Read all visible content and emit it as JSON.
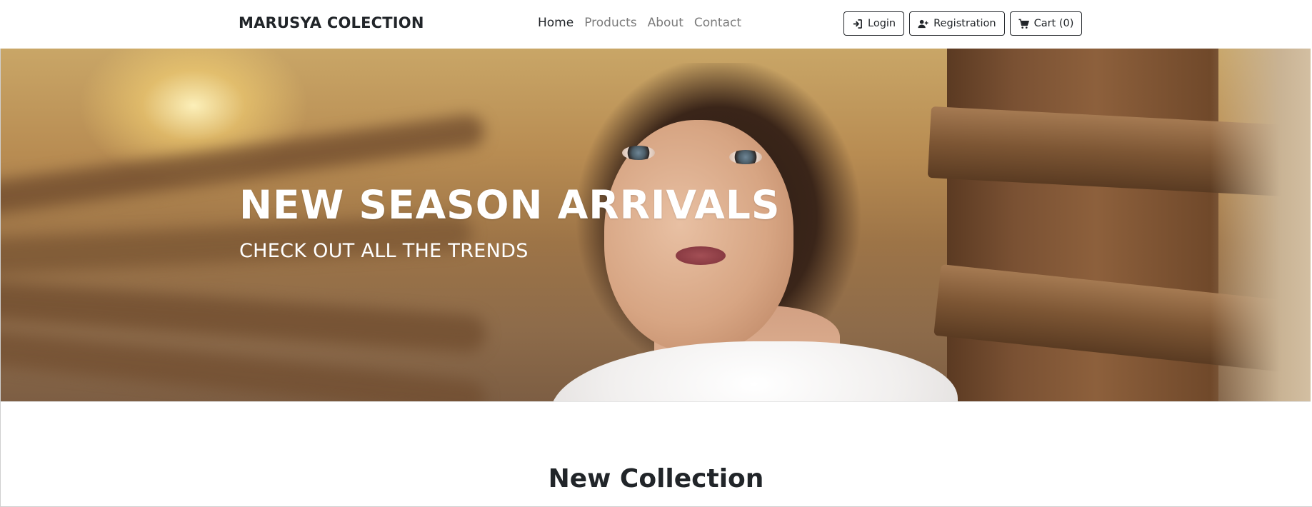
{
  "brand": {
    "name": "MARUSYA COLECTION"
  },
  "nav": {
    "links": [
      {
        "label": "Home",
        "active": true
      },
      {
        "label": "Products",
        "active": false
      },
      {
        "label": "About",
        "active": false
      },
      {
        "label": "Contact",
        "active": false
      }
    ],
    "buttons": {
      "login": {
        "label": "Login",
        "icon": "sign-in-icon"
      },
      "registration": {
        "label": "Registration",
        "icon": "user-plus-icon"
      },
      "cart": {
        "label": "Cart (0)",
        "icon": "cart-icon"
      }
    }
  },
  "hero": {
    "title": "NEW SEASON ARRIVALS",
    "subtitle": "CHECK OUT ALL THE TRENDS"
  },
  "section": {
    "title": "New Collection"
  },
  "colors": {
    "text": "#212529",
    "muted_link": "#7a7a7a",
    "background": "#ffffff"
  }
}
